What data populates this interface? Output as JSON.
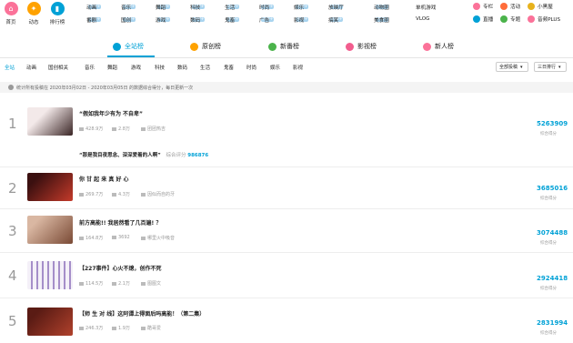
{
  "header": {
    "icons": [
      {
        "label": "首页",
        "icon": "home-icon",
        "color": "#fb7299"
      },
      {
        "label": "动态",
        "icon": "dynamic-icon",
        "color": "#ffa200"
      },
      {
        "label": "排行榜",
        "icon": "ranking-icon",
        "color": "#00a1d6"
      }
    ],
    "nav_row1": [
      {
        "label": "动画",
        "badge": "999+"
      },
      {
        "label": "音乐",
        "badge": "999+"
      },
      {
        "label": "舞蹈",
        "badge": "999+"
      },
      {
        "label": "科技",
        "badge": "999+"
      },
      {
        "label": "生活",
        "badge": "999+"
      },
      {
        "label": "时尚",
        "badge": "999+"
      },
      {
        "label": "娱乐",
        "badge": "999+"
      },
      {
        "label": "放映厅",
        "badge": "999+"
      },
      {
        "label": "动物圈",
        "badge": "999+"
      },
      {
        "label": "美食圈",
        "badge": "999+"
      }
    ],
    "nav_row2": [
      {
        "label": "番剧",
        "badge": "999+"
      },
      {
        "label": "国创",
        "badge": "999+"
      },
      {
        "label": "游戏",
        "badge": "999+"
      },
      {
        "label": "数码",
        "badge": "999+"
      },
      {
        "label": "鬼畜",
        "badge": "999+"
      },
      {
        "label": "广告",
        "badge": "999+"
      },
      {
        "label": "影视",
        "badge": "999+"
      },
      {
        "label": "搞笑",
        "badge": "999+"
      },
      {
        "label": "单机游戏",
        "badge": ""
      },
      {
        "label": "VLOG",
        "badge": ""
      }
    ],
    "right_links": [
      {
        "label": "专栏",
        "icon": "column-icon",
        "color": "#fb7299"
      },
      {
        "label": "活动",
        "icon": "activity-icon",
        "color": "#ff6c3a"
      },
      {
        "label": "小黑屋",
        "icon": "blackroom-icon",
        "color": "#e7b21d"
      },
      {
        "label": "直播",
        "icon": "live-icon",
        "color": "#00a1d6"
      },
      {
        "label": "专题",
        "icon": "topic-icon",
        "color": "#4bb34b"
      },
      {
        "label": "音频PLUS",
        "icon": "audio-icon",
        "color": "#fb7299"
      }
    ]
  },
  "tabs": [
    {
      "label": "全站榜",
      "icon": "chart-icon",
      "color": "#00a1d6",
      "active": true
    },
    {
      "label": "原创榜",
      "icon": "crown-icon",
      "color": "#ffa200",
      "active": false
    },
    {
      "label": "新番榜",
      "icon": "new-icon",
      "color": "#4bb34b",
      "active": false
    },
    {
      "label": "影视榜",
      "icon": "film-icon",
      "color": "#f25d8e",
      "active": false
    },
    {
      "label": "新人榜",
      "icon": "newbie-icon",
      "color": "#fb7299",
      "active": false
    }
  ],
  "categories": [
    "全站",
    "动画",
    "国创相关",
    "音乐",
    "舞蹈",
    "游戏",
    "科技",
    "数码",
    "生活",
    "鬼畜",
    "时尚",
    "娱乐",
    "影视"
  ],
  "filters": {
    "type": "全部投稿",
    "range": "三日排行"
  },
  "notice": "统计所有投稿在 2020年03月02日 - 2020年03月05日 的数据综合得分，每日更新一次",
  "items": [
    {
      "rank": "1",
      "title": "“假如我年少有为 不自卑”",
      "plays": "428.9万",
      "comments": "2.8万",
      "author": "团团热吉",
      "score": "5263909",
      "score_label": "综合得分",
      "thumb": [
        "#f3e9e9",
        "#3a2525"
      ],
      "extra_title": "“那是我目夜思念、深深爱着的人啊”",
      "extra_score_label": "综合评分",
      "extra_score": "986876"
    },
    {
      "rank": "2",
      "title": "你 甘 起 来 真 好 心",
      "plays": "269.7万",
      "comments": "4.3万",
      "author": "因似而自的牙",
      "score": "3685016",
      "score_label": "综合得分",
      "thumb": [
        "#3b1010",
        "#c43a2a"
      ]
    },
    {
      "rank": "3",
      "title": "前方高能!! 我居然看了几百遍! ？",
      "plays": "164.8万",
      "comments": "3692",
      "author": "哪里火中吸音",
      "score": "3074488",
      "score_label": "综合得分",
      "thumb": [
        "#d9b7a2",
        "#7a4a35"
      ]
    },
    {
      "rank": "4",
      "title": "【227事件】心火不熄，创作不死",
      "plays": "114.5万",
      "comments": "2.1万",
      "author": "图图文",
      "score": "2924418",
      "score_label": "综合得分",
      "thumb": [
        "#f4f0f8",
        "#a58ec9"
      ]
    },
    {
      "rank": "5",
      "title": "【师 生 对 线】这阿谭上得面后吗高能！（第二集）",
      "plays": "246.3万",
      "comments": "1.9万",
      "author": "酷哥爱",
      "score": "2831994",
      "score_label": "综合得分",
      "thumb": [
        "#5a1b14",
        "#b0412c"
      ]
    }
  ]
}
